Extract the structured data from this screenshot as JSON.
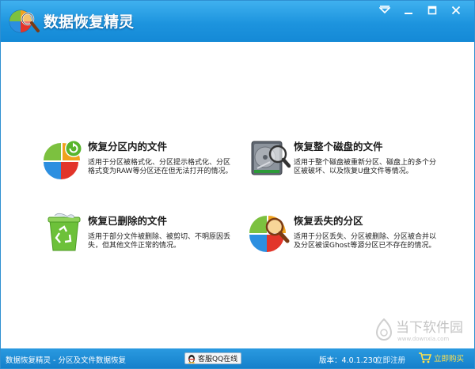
{
  "window": {
    "title": "数据恢复精灵",
    "buttons": {
      "menu": "menu-icon",
      "minimize": "minimize-icon",
      "maximize": "maximize-icon",
      "close": "close-icon"
    }
  },
  "cards": [
    {
      "title": "恢复分区内的文件",
      "desc": "适用于分区被格式化、分区提示格式化、分区格式变为RAW等分区还在但无法打开的情况。",
      "icon": "pie-recover-icon"
    },
    {
      "title": "恢复整个磁盘的文件",
      "desc": "适用于整个磁盘被重新分区、磁盘上的多个分区被破坏、以及恢复U盘文件等情况。",
      "icon": "disk-search-icon"
    },
    {
      "title": "恢复已删除的文件",
      "desc": "适用于部分文件被删除、被剪切、不明原因丢失，但其他文件正常的情况。",
      "icon": "recycle-bin-icon"
    },
    {
      "title": "恢复丢失的分区",
      "desc": "适用于分区丢失、分区被删除、分区被合并以及分区被误Ghost等源分区已不存在的情况。",
      "icon": "pie-search-icon"
    }
  ],
  "watermark": {
    "text": "当下软件园",
    "sub": "www.downxia.com"
  },
  "statusbar": {
    "left": "数据恢复精灵 - 分区及文件数据恢复",
    "qq": "客服QQ在线",
    "version": "版本：4.0.1.230",
    "register": "立即注册",
    "buy": "立即购买"
  },
  "colors": {
    "titlebar": "#1d94de",
    "statusbar": "#1580cb",
    "buy_text": "#ffe14d"
  }
}
